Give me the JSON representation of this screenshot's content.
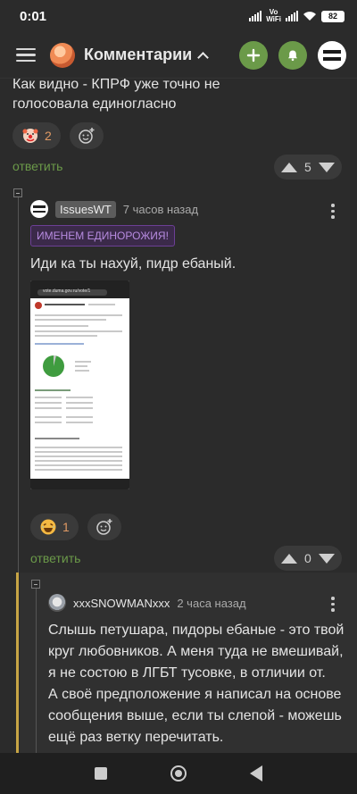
{
  "status_bar": {
    "time": "0:01",
    "volte_top": "Vo",
    "volte_bottom": "WiFi",
    "battery": "82"
  },
  "app_bar": {
    "title": "Комментарии"
  },
  "comment_prev": {
    "text_line1": "Как видно - КПРФ уже точно не",
    "text_line2": "голосовала единогласно",
    "reaction_count": "2",
    "reply_label": "ответить",
    "votes": "5"
  },
  "comment_main": {
    "author": "IssuesWT",
    "time": "7 часов назад",
    "badge": "ИМЕНЕМ ЕДИНОРОЖИЯ!",
    "text": "Иди ка ты нахуй, пидр ебаный.",
    "image_url_text": "vote.duma.gov.ru/vote/1",
    "reaction_count": "1",
    "reply_label": "ответить",
    "votes": "0"
  },
  "comment_nested": {
    "author": "xxxSNOWMANxxx",
    "time": "2 часа назад",
    "line1": "Слышь петушара, пидоры ебаные - это твой",
    "line2": "круг любовников. А меня туда не вмешивай,",
    "line3": "я не состою в ЛГБТ тусовке, в отличии от.",
    "line4": "А своё предположение я написал на основе",
    "line5": "сообщения выше, если ты слепой - можешь",
    "line6": "ещё раз ветку перечитать."
  },
  "colors": {
    "accent_green": "#6b9a49",
    "background": "#2b2b2b",
    "badge_purple": "#b78be0",
    "nested_border": "#c7a545"
  }
}
